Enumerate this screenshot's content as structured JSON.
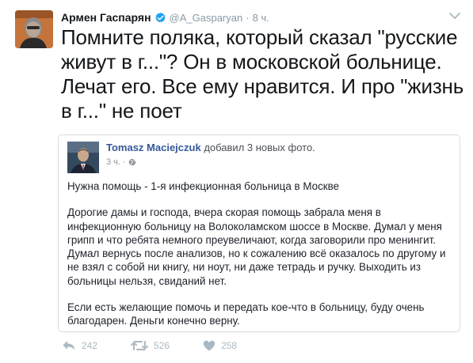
{
  "tweet": {
    "author_name": "Армен Гаспарян",
    "handle": "@A_Gasparyan",
    "separator": "·",
    "time": "8 ч.",
    "text": "Помните поляка, который сказал \"русские живут в г...\"? Он в московской больнице. Лечат его. Все ему нравится. И про \"жизнь в г...\" не поет"
  },
  "embedded_post": {
    "author": "Tomasz Maciejczuk",
    "action": "добавил 3 новых фото.",
    "time": "3 ч.",
    "dot": "·",
    "paragraphs": [
      "Нужна помощь - 1-я инфекционная больница в Москве",
      "Дорогие дамы и господа, вчера скорая помощь забрала меня в инфекционную больницу на Волоколамском шоссе в Москве. Думал у меня грипп и что ребята немного преувеличают, когда заговорили про менингит. Думал вернусь после анализов, но к сожалению всё оказалось по другому и не взял с собой ни книгу, ни ноут, ни даже тетрадь и ручку. Выходить из больницы нельзя, свиданий нет.",
      "Если есть желающие помочь и передать кое-что в больницу, буду очень благодарен. Деньги конечно верну."
    ]
  },
  "actions": {
    "reply_count": "242",
    "retweet_count": "526",
    "like_count": "258"
  },
  "icons": {
    "verified": "verified-badge-icon",
    "caret": "chevron-down-icon",
    "reply": "reply-icon",
    "retweet": "retweet-icon",
    "like": "heart-icon",
    "privacy": "globe-icon"
  },
  "colors": {
    "verified_blue": "#1da1f2",
    "muted": "#aab8c2",
    "fb_link": "#365899"
  }
}
